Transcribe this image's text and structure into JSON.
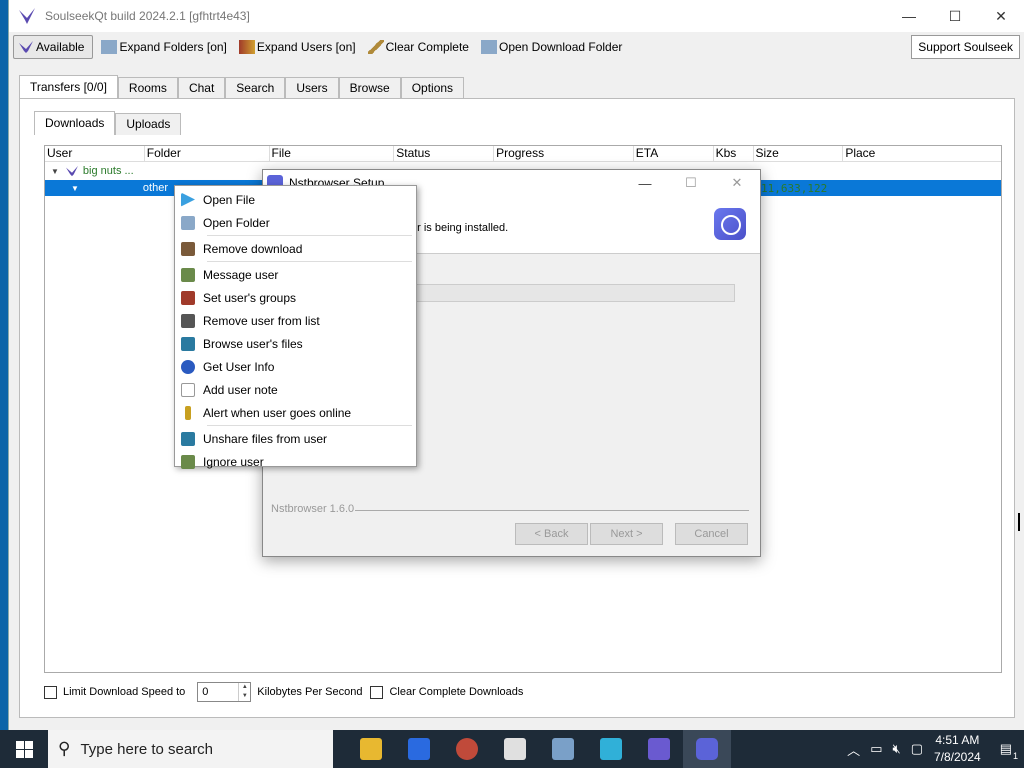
{
  "window": {
    "title": "SoulseekQt build 2024.2.1 [gfhtrt4e43]",
    "controls": {
      "minimize": "—",
      "maximize": "☐",
      "close": "✕"
    }
  },
  "toolbar": {
    "available": "Available",
    "expand_folders": "Expand Folders [on]",
    "expand_users": "Expand Users [on]",
    "clear_complete": "Clear Complete",
    "open_download_folder": "Open Download Folder",
    "support": "Support Soulseek"
  },
  "main_tabs": [
    "Transfers [0/0]",
    "Rooms",
    "Chat",
    "Search",
    "Users",
    "Browse",
    "Options"
  ],
  "sub_tabs": [
    "Downloads",
    "Uploads"
  ],
  "grid": {
    "columns": [
      "User",
      "Folder",
      "File",
      "Status",
      "Progress",
      "ETA",
      "Kbs",
      "Size",
      "Place"
    ],
    "user_row": {
      "user": "big nuts ..."
    },
    "selected_row": {
      "folder": "other"
    },
    "size_value": "11,633,122"
  },
  "bottom": {
    "limit_label": "Limit Download Speed to",
    "speed_value": "0",
    "unit_label": "Kilobytes Per Second",
    "clear_label": "Clear Complete Downloads"
  },
  "installer": {
    "title": "Nstbrowser Setup",
    "subtitle": "er is being installed.",
    "version": "Nstbrowser 1.6.0",
    "back": "< Back",
    "next": "Next >",
    "cancel": "Cancel"
  },
  "context_menu": {
    "items": [
      {
        "label": "Open File",
        "icon": "play-icon",
        "color": "#3aa0e0"
      },
      {
        "label": "Open Folder",
        "icon": "folder-icon",
        "color": "#8aa8c8"
      },
      {
        "label": "Remove download",
        "icon": "remove-download-icon",
        "color": "#7a5a3a"
      },
      {
        "label": "Message user",
        "icon": "message-icon",
        "color": "#6a8a4a"
      },
      {
        "label": "Set user's groups",
        "icon": "groups-icon",
        "color": "#a03a2a"
      },
      {
        "label": "Remove user from list",
        "icon": "remove-user-icon",
        "color": "#555555"
      },
      {
        "label": "Browse user's files",
        "icon": "browse-icon",
        "color": "#2a7aa0"
      },
      {
        "label": "Get User Info",
        "icon": "info-icon",
        "color": "#2a5ac0"
      },
      {
        "label": "Add user note",
        "icon": "note-icon",
        "color": "#cccccc"
      },
      {
        "label": "Alert when user goes online",
        "icon": "alert-icon",
        "color": "#c8a020"
      },
      {
        "label": "Unshare files from user",
        "icon": "unshare-icon",
        "color": "#2a7aa0"
      },
      {
        "label": "Ignore user",
        "icon": "ignore-icon",
        "color": "#6a8a4a"
      }
    ]
  },
  "taskbar": {
    "search_placeholder": "Type here to search",
    "time": "4:51 AM",
    "date": "7/8/2024",
    "notification_count": "1"
  }
}
